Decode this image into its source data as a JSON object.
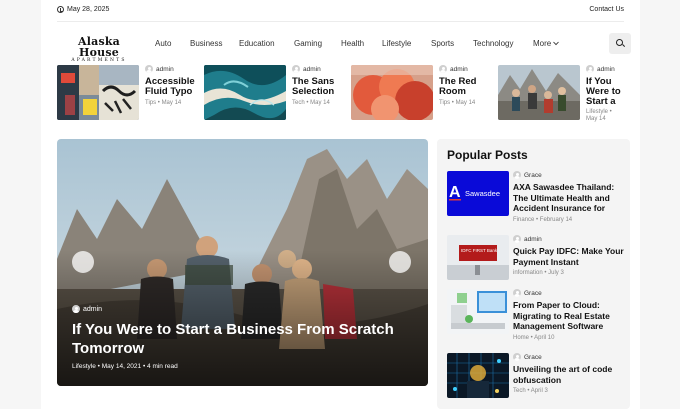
{
  "topbar": {
    "date": "May 28, 2025",
    "contact": "Contact Us"
  },
  "logo": {
    "line1": "Alaska House",
    "line2": "APARTMENTS"
  },
  "nav": [
    "Auto",
    "Business",
    "Education",
    "Gaming",
    "Health",
    "Lifestyle",
    "Sports",
    "Technology",
    "More"
  ],
  "ticker": [
    {
      "author": "admin",
      "title_lines": [
        "Accessible",
        "Fluid Typo"
      ],
      "category": "Tips",
      "date": "May 14"
    },
    {
      "author": "admin",
      "title_lines": [
        "The Sans",
        "Selection"
      ],
      "category": "Tech",
      "date": "May 14"
    },
    {
      "author": "admin",
      "title_lines": [
        "The Red",
        "Room"
      ],
      "category": "Tips",
      "date": "May 14"
    },
    {
      "author": "admin",
      "title_lines": [
        "If You",
        "Were to",
        "Start a"
      ],
      "category": "Lifestyle",
      "date": "May 14"
    }
  ],
  "hero": {
    "author": "admin",
    "title": "If You Were to Start a Business From Scratch Tomorrow",
    "category": "Lifestyle",
    "date": "May 14, 2021",
    "read_time": "4 min read"
  },
  "popular": {
    "heading": "Popular Posts",
    "items": [
      {
        "author": "Grace",
        "title": "AXA Sawasdee Thailand: The Ultimate Health and Accident Insurance for",
        "category": "Finance",
        "date": "February 14",
        "thumb_text": "Sawasdee",
        "thumb_logo": "A"
      },
      {
        "author": "admin",
        "title": "Quick Pay IDFC: Make Your Payment Instant",
        "category": "information",
        "date": "July 3",
        "thumb_text": "IDFC FIRST Bank"
      },
      {
        "author": "Grace",
        "title": "From Paper to Cloud: Migrating to Real Estate Management Software",
        "category": "Home",
        "date": "April 10"
      },
      {
        "author": "Grace",
        "title": "Unveiling the art of code obfuscation",
        "category": "Tech",
        "date": "April 3"
      }
    ]
  },
  "colors": {
    "accent": "#0a0ad8",
    "idfc_red": "#b31b1b"
  }
}
